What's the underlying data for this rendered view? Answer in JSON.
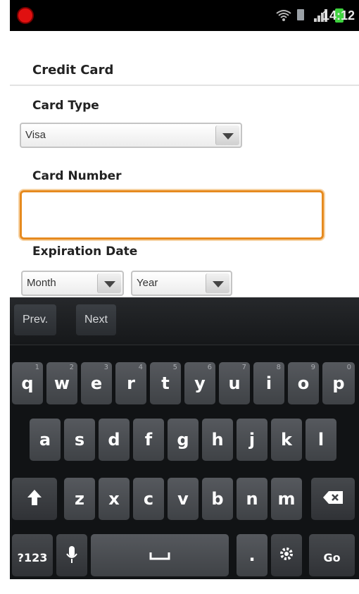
{
  "status_bar": {
    "time": "14:12",
    "icons": [
      "record-icon",
      "wifi-icon",
      "sdcard-icon",
      "signal-icon",
      "battery-icon"
    ],
    "record_color": "#e01010",
    "battery_color": "#3fd23f"
  },
  "form": {
    "section_title": "Credit Card",
    "card_type_label": "Card Type",
    "card_type_value": "Visa",
    "card_number_label": "Card Number",
    "card_number_value": "",
    "expiration_label": "Expiration Date",
    "month_value": "Month",
    "year_value": "Year",
    "focus_color": "#e68a1f"
  },
  "keyboard": {
    "toolbar": {
      "prev": "Prev.",
      "next": "Next"
    },
    "row1": [
      {
        "key": "q",
        "hint": "1"
      },
      {
        "key": "w",
        "hint": "2"
      },
      {
        "key": "e",
        "hint": "3"
      },
      {
        "key": "r",
        "hint": "4"
      },
      {
        "key": "t",
        "hint": "5"
      },
      {
        "key": "y",
        "hint": "6"
      },
      {
        "key": "u",
        "hint": "7"
      },
      {
        "key": "i",
        "hint": "8"
      },
      {
        "key": "o",
        "hint": "9"
      },
      {
        "key": "p",
        "hint": "0"
      }
    ],
    "row2": [
      "a",
      "s",
      "d",
      "f",
      "g",
      "h",
      "j",
      "k",
      "l"
    ],
    "row3": [
      "z",
      "x",
      "c",
      "v",
      "b",
      "n",
      "m"
    ],
    "row3_special": {
      "shift": "shift-icon",
      "backspace": "backspace-icon"
    },
    "row4": {
      "symbols": "?123",
      "mic": "microphone-icon",
      "space": "space-icon",
      "period": ".",
      "settings": "settings-icon",
      "go": "Go"
    }
  }
}
